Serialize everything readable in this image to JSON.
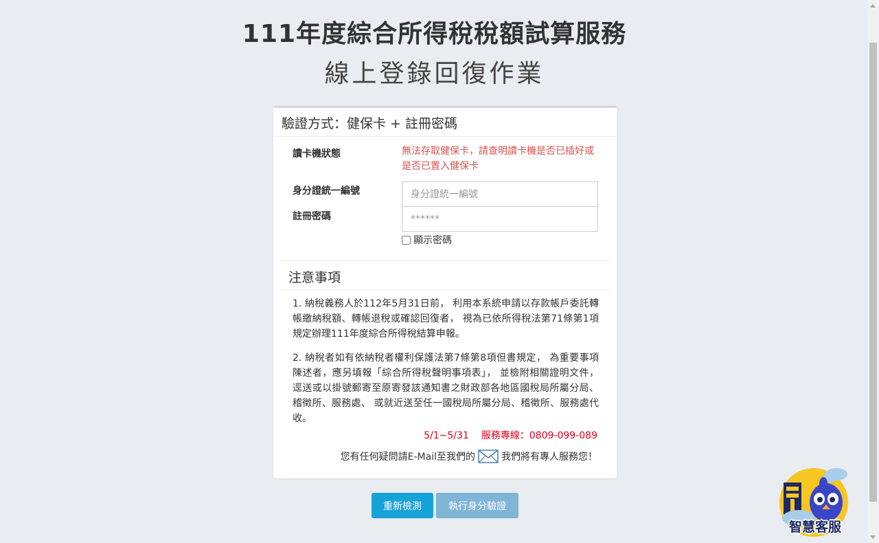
{
  "page": {
    "title": "111年度綜合所得稅稅額試算服務",
    "subtitle": "線上登錄回復作業"
  },
  "card": {
    "header": "驗證方式：健保卡 + 註冊密碼",
    "reader_status_label": "讀卡機狀態",
    "reader_status_text": "無法存取健保卡，請查明讀卡機是否已插好或是否已置入健保卡",
    "id_label": "身分證統一編號",
    "id_placeholder": "身分證統一編號",
    "password_label": "註冊密碼",
    "password_placeholder": "******",
    "show_password_label": "顯示密碼"
  },
  "notice": {
    "title": "注意事項",
    "items": [
      "1. 納稅義務人於112年5月31日前， 利用本系統申請以存款帳戶委託轉帳繳納稅額、轉帳退稅或確認回復者， 視為已依所得稅法第71條第1項規定辦理111年度綜合所得稅結算申報。",
      "2. 納稅者如有依納稅者權利保護法第7條第8項但書規定， 為重要事項陳述者，應另填報「綜合所得稅聲明事項表」， 並檢附相關證明文件， 逕送或以掛號郵寄至原寄發該通知書之財政部各地區國稅局所屬分局、稽徵所、服務處、 或就近送至任一國稅局所屬分局、稽徵所、服務處代收。"
    ],
    "service_period": "5/1~5/31",
    "hotline": "服務專線：0809-099-089",
    "email_prefix": "您有任何疑問請E-Mail至我們的",
    "email_suffix": "我們將有專人服務您！"
  },
  "buttons": {
    "recheck": "重新檢測",
    "verify": "執行身分驗證"
  },
  "chatbot": {
    "label": "智慧客服"
  },
  "icons": {
    "mail": "envelope-icon",
    "chatbot": "bird-mascot-icon"
  },
  "colors": {
    "error_red": "#d9534f",
    "hotline_red": "#e0001b",
    "primary_button": "#17a2d8",
    "disabled_button": "#7fb5d6"
  }
}
